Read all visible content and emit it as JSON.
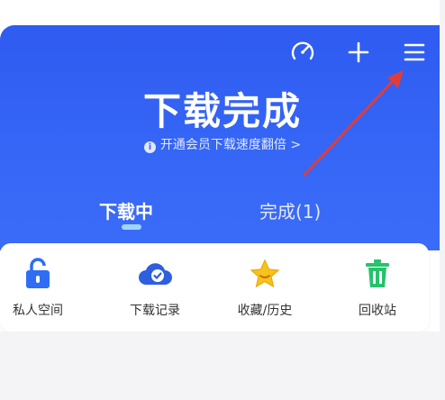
{
  "header": {
    "title": "下载完成",
    "promo_text": "开通会员下载速度翻倍 >",
    "icons": [
      "speed-icon",
      "plus-icon",
      "menu-icon"
    ]
  },
  "tabs": [
    {
      "label": "下载中",
      "active": true
    },
    {
      "label": "完成(1)",
      "active": false
    }
  ],
  "tools": [
    {
      "label": "私人空间",
      "icon": "lock-icon"
    },
    {
      "label": "下载记录",
      "icon": "cloud-check-icon"
    },
    {
      "label": "收藏/历史",
      "icon": "star-icon"
    },
    {
      "label": "回收站",
      "icon": "trash-icon"
    }
  ],
  "colors": {
    "header": "#3566f6",
    "indicator": "#9fd6ff",
    "lock": "#2f6df5",
    "cloud": "#2d5fe0",
    "star": "#f6c21c",
    "trash": "#26c26c",
    "annotation": "#e03c3c"
  }
}
